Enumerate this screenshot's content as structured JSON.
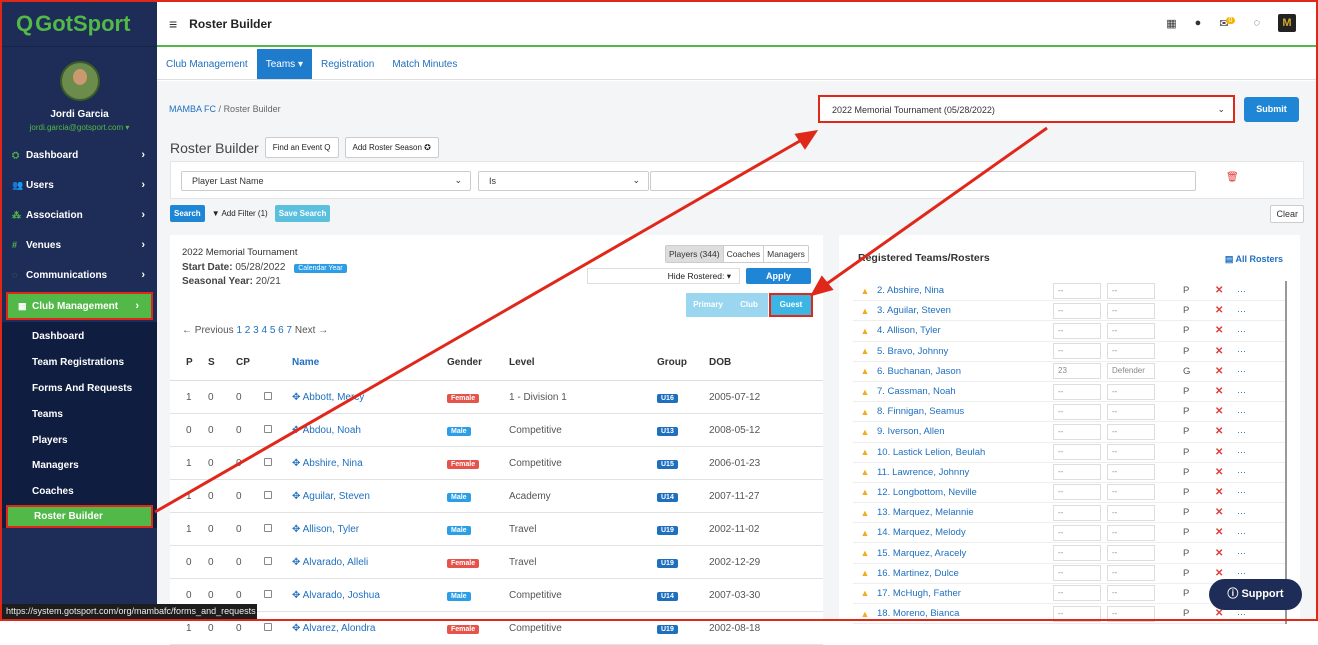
{
  "brand": {
    "logo_text": "GotSport",
    "logo_glyph": "Q"
  },
  "user": {
    "name": "Jordi Garcia",
    "email": "jordi.garcia@gotsport.com ▾"
  },
  "sidebar": {
    "items": [
      {
        "label": "Dashboard",
        "icon": "dashboard-icon"
      },
      {
        "label": "Users",
        "icon": "users-icon"
      },
      {
        "label": "Association",
        "icon": "association-icon"
      },
      {
        "label": "Venues",
        "icon": "venues-icon"
      },
      {
        "label": "Communications",
        "icon": "communications-icon"
      },
      {
        "label": "Club Management",
        "icon": "club-management-icon"
      }
    ],
    "subitems": [
      "Dashboard",
      "Team Registrations",
      "Forms And Requests",
      "Teams",
      "Players",
      "Managers",
      "Coaches",
      "Roster Builder"
    ]
  },
  "status_url": "https://system.gotsport.com/org/mambafc/forms_and_requests",
  "topbar": {
    "title": "Roster Builder",
    "mail_badge": "0",
    "menu_glyph": "≡",
    "org_glyph": "M"
  },
  "tabs": [
    "Club Management",
    "Teams ▾",
    "Registration",
    "Match Minutes"
  ],
  "breadcrumb": {
    "org": "MAMBA FC",
    "sep": "/",
    "page": "Roster Builder"
  },
  "event_select": {
    "value": "2022 Memorial Tournament (05/28/2022)"
  },
  "submit_label": "Submit",
  "roster_builder": {
    "title": "Roster Builder",
    "find_event": "Find an Event Q",
    "add_season": "Add Roster Season ✪"
  },
  "filter": {
    "field": "Player Last Name",
    "operator": "Is",
    "value": ""
  },
  "actions": {
    "search": "Search",
    "add_filter": "▼ Add Filter (1)",
    "save_search": "Save Search",
    "clear": "Clear"
  },
  "event": {
    "title": "2022 Memorial Tournament",
    "start_label": "Start Date:",
    "start_value": "05/28/2022",
    "calendar_pill": "Calendar Year",
    "seasonal_label": "Seasonal Year:",
    "seasonal_value": "20/21"
  },
  "segments": [
    "Players (344)",
    "Coaches",
    "Managers"
  ],
  "hide_rostered": "Hide Rostered: ▾",
  "apply_label": "Apply",
  "player_types": [
    "Primary",
    "Club Pass",
    "Guest"
  ],
  "pager": {
    "prev": "← Previous",
    "pages": "1 2 3 4 5 6 7",
    "next": "Next →"
  },
  "columns": [
    "P",
    "S",
    "CP",
    "",
    "Name",
    "Gender",
    "Level",
    "Group",
    "DOB"
  ],
  "players": [
    {
      "p": "1",
      "s": "0",
      "cp": "0",
      "name": "Abbott, Mercy",
      "gender": "Female",
      "level": "1 - Division 1",
      "group": "U16",
      "dob": "2005-07-12"
    },
    {
      "p": "0",
      "s": "0",
      "cp": "0",
      "name": "Abdou, Noah",
      "gender": "Male",
      "level": "Competitive",
      "group": "U13",
      "dob": "2008-05-12"
    },
    {
      "p": "1",
      "s": "0",
      "cp": "0",
      "name": "Abshire, Nina",
      "gender": "Female",
      "level": "Competitive",
      "group": "U15",
      "dob": "2006-01-23"
    },
    {
      "p": "1",
      "s": "0",
      "cp": "0",
      "name": "Aguilar, Steven",
      "gender": "Male",
      "level": "Academy",
      "group": "U14",
      "dob": "2007-11-27"
    },
    {
      "p": "1",
      "s": "0",
      "cp": "0",
      "name": "Allison, Tyler",
      "gender": "Male",
      "level": "Travel",
      "group": "U19",
      "dob": "2002-11-02"
    },
    {
      "p": "0",
      "s": "0",
      "cp": "0",
      "name": "Alvarado, Alleli",
      "gender": "Female",
      "level": "Travel",
      "group": "U19",
      "dob": "2002-12-29"
    },
    {
      "p": "0",
      "s": "0",
      "cp": "0",
      "name": "Alvarado, Joshua",
      "gender": "Male",
      "level": "Competitive",
      "group": "U14",
      "dob": "2007-03-30"
    },
    {
      "p": "1",
      "s": "0",
      "cp": "0",
      "name": "Alvarez, Alondra",
      "gender": "Female",
      "level": "Competitive",
      "group": "U19",
      "dob": "2002-08-18"
    }
  ],
  "registered": {
    "title": "Registered Teams/Rosters",
    "all_rosters": "All Rosters",
    "rows": [
      {
        "name": "2. Abshire, Nina",
        "num": "--",
        "pos": "--",
        "type": "P"
      },
      {
        "name": "3. Aguilar, Steven",
        "num": "--",
        "pos": "--",
        "type": "P"
      },
      {
        "name": "4. Allison, Tyler",
        "num": "--",
        "pos": "--",
        "type": "P"
      },
      {
        "name": "5. Bravo, Johnny",
        "num": "--",
        "pos": "--",
        "type": "P"
      },
      {
        "name": "6. Buchanan, Jason",
        "num": "23",
        "pos": "Defender",
        "type": "G"
      },
      {
        "name": "7. Cassman, Noah",
        "num": "--",
        "pos": "--",
        "type": "P"
      },
      {
        "name": "8. Finnigan, Seamus",
        "num": "--",
        "pos": "--",
        "type": "P"
      },
      {
        "name": "9. Iverson, Allen",
        "num": "--",
        "pos": "--",
        "type": "P"
      },
      {
        "name": "10. Lastick Lelion, Beulah",
        "num": "--",
        "pos": "--",
        "type": "P"
      },
      {
        "name": "11. Lawrence, Johnny",
        "num": "--",
        "pos": "--",
        "type": "P"
      },
      {
        "name": "12. Longbottom, Neville",
        "num": "--",
        "pos": "--",
        "type": "P"
      },
      {
        "name": "13. Marquez, Melannie",
        "num": "--",
        "pos": "--",
        "type": "P"
      },
      {
        "name": "14. Marquez, Melody",
        "num": "--",
        "pos": "--",
        "type": "P"
      },
      {
        "name": "15. Marquez, Aracely",
        "num": "--",
        "pos": "--",
        "type": "P"
      },
      {
        "name": "16. Martinez, Dulce",
        "num": "--",
        "pos": "--",
        "type": "P"
      },
      {
        "name": "17. McHugh, Father",
        "num": "--",
        "pos": "--",
        "type": "P"
      },
      {
        "name": "18. Moreno, Bianca",
        "num": "--",
        "pos": "--",
        "type": "P"
      }
    ]
  },
  "support_label": "Support",
  "colors": {
    "brand_green": "#52b948",
    "navy": "#1d2d57",
    "accent_blue": "#1f86d6",
    "highlight_red": "#e0281a"
  }
}
